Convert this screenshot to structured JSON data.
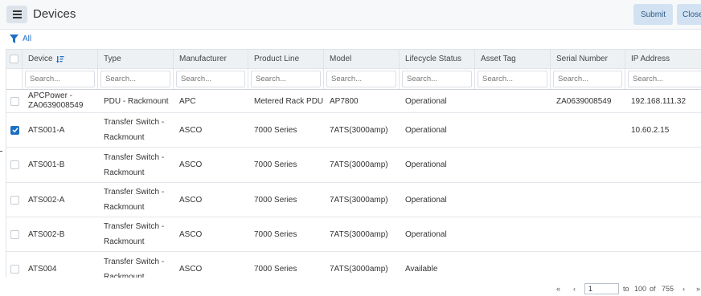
{
  "header": {
    "title": "Devices",
    "submit_label": "Submit",
    "close_label": "Close"
  },
  "filter": {
    "label": "All"
  },
  "columns": [
    "Device",
    "Type",
    "Manufacturer",
    "Product Line",
    "Model",
    "Lifecycle Status",
    "Asset Tag",
    "Serial Number",
    "IP Address"
  ],
  "search_placeholder": "Search...",
  "rows": [
    {
      "checked": false,
      "device": "APCPower - ZA0639008549",
      "type": "PDU - Rackmount",
      "manufacturer": "APC",
      "product_line": "Metered Rack PDU",
      "model": "AP7800",
      "lifecycle": "Operational",
      "asset_tag": "",
      "serial": "ZA0639008549",
      "ip": "192.168.111.32"
    },
    {
      "checked": true,
      "device": "ATS001-A",
      "type": "Transfer Switch - Rackmount",
      "manufacturer": "ASCO",
      "product_line": "7000 Series",
      "model": "7ATS(3000amp)",
      "lifecycle": "Operational",
      "asset_tag": "",
      "serial": "",
      "ip": "10.60.2.15"
    },
    {
      "checked": false,
      "device": "ATS001-B",
      "type": "Transfer Switch - Rackmount",
      "manufacturer": "ASCO",
      "product_line": "7000 Series",
      "model": "7ATS(3000amp)",
      "lifecycle": "Operational",
      "asset_tag": "",
      "serial": "",
      "ip": ""
    },
    {
      "checked": false,
      "device": "ATS002-A",
      "type": "Transfer Switch - Rackmount",
      "manufacturer": "ASCO",
      "product_line": "7000 Series",
      "model": "7ATS(3000amp)",
      "lifecycle": "Operational",
      "asset_tag": "",
      "serial": "",
      "ip": ""
    },
    {
      "checked": false,
      "device": "ATS002-B",
      "type": "Transfer Switch - Rackmount",
      "manufacturer": "ASCO",
      "product_line": "7000 Series",
      "model": "7ATS(3000amp)",
      "lifecycle": "Operational",
      "asset_tag": "",
      "serial": "",
      "ip": ""
    },
    {
      "checked": false,
      "device": "ATS004",
      "type": "Transfer Switch - Rackmount",
      "manufacturer": "ASCO",
      "product_line": "7000 Series",
      "model": "7ATS(3000amp)",
      "lifecycle": "Available",
      "asset_tag": "",
      "serial": "",
      "ip": ""
    }
  ],
  "pagination": {
    "first": "«",
    "prev": "‹",
    "page": "1",
    "to": "to",
    "page_size": "100",
    "of": "of",
    "total": "755",
    "next": "›",
    "last": "»"
  },
  "icons": {
    "menu": "hamburger-icon",
    "filter": "filter-icon",
    "sort": "sort-descending-icon",
    "check": "checkmark-icon"
  },
  "colors": {
    "accent": "#1f6fc4",
    "button_bg": "#d3e2f2",
    "header_bg": "#eef1f4"
  }
}
